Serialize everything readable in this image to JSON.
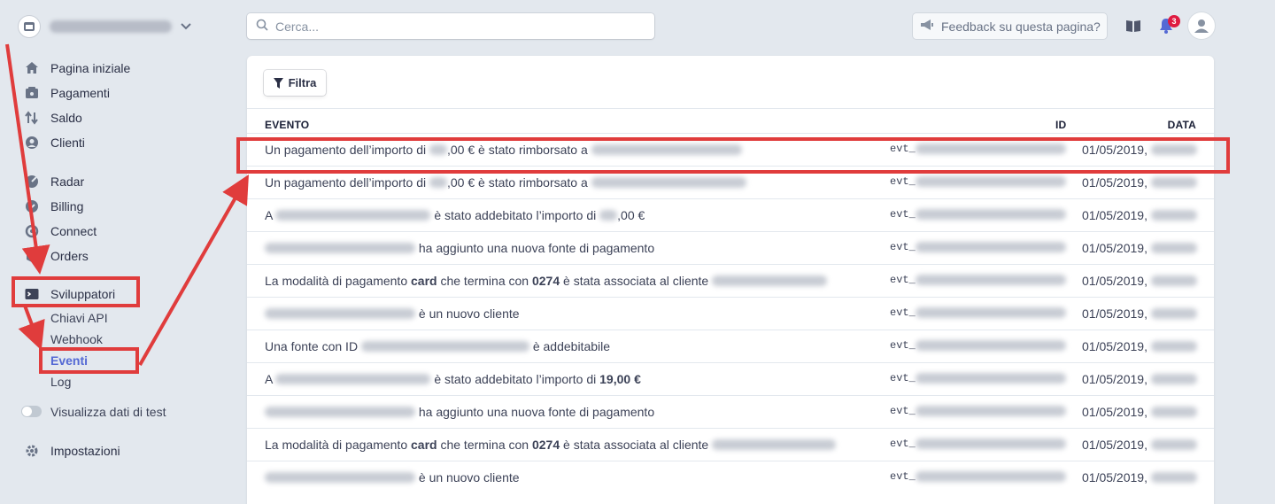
{
  "sidebar": {
    "nav_primary": [
      {
        "label": "Pagina iniziale",
        "icon": "home-icon"
      },
      {
        "label": "Pagamenti",
        "icon": "payments-icon"
      },
      {
        "label": "Saldo",
        "icon": "balance-icon"
      },
      {
        "label": "Clienti",
        "icon": "customers-icon"
      }
    ],
    "nav_secondary": [
      {
        "label": "Radar",
        "icon": "radar-icon"
      },
      {
        "label": "Billing",
        "icon": "billing-icon"
      },
      {
        "label": "Connect",
        "icon": "connect-icon"
      },
      {
        "label": "Orders",
        "icon": "orders-icon"
      }
    ],
    "developers": {
      "label": "Sviluppatori",
      "icon": "terminal-icon",
      "sub_items": [
        "Chiavi API",
        "Webhook",
        "Eventi",
        "Log"
      ],
      "active": "Eventi"
    },
    "test_toggle_label": "Visualizza dati di test",
    "settings_label": "Impostazioni"
  },
  "topbar": {
    "search_placeholder": "Cerca...",
    "feedback_label": "Feedback su questa pagina?",
    "notification_count": "3"
  },
  "main": {
    "filter_label": "Filtra",
    "columns": {
      "event": "EVENTO",
      "id": "ID",
      "date": "DATA"
    },
    "rows": [
      {
        "parts": [
          "Un pagamento dell’importo di ",
          "{B:20}",
          ",00 € è stato rimborsato a ",
          "{B:170}"
        ],
        "id_prefix": "evt_",
        "date": "01/05/2019,"
      },
      {
        "parts": [
          "Un pagamento dell’importo di ",
          "{B:20}",
          ",00 € è stato rimborsato a ",
          "{B:175}"
        ],
        "id_prefix": "evt_",
        "date": "01/05/2019,"
      },
      {
        "parts": [
          "A ",
          "{B:175}",
          " è stato addebitato l’importo di ",
          "{B:20}",
          ",00 €"
        ],
        "id_prefix": "evt_",
        "date": "01/05/2019,"
      },
      {
        "parts": [
          "{B:170}",
          " ha aggiunto una nuova fonte di pagamento"
        ],
        "id_prefix": "evt_",
        "date": "01/05/2019,"
      },
      {
        "parts": [
          "La modalità di pagamento ",
          "*card",
          " che termina con ",
          "*0274",
          " è stata associata al cliente ",
          "{B:130}"
        ],
        "id_prefix": "evt_",
        "date": "01/05/2019,"
      },
      {
        "parts": [
          "{B:170}",
          " è un nuovo cliente"
        ],
        "id_prefix": "evt_",
        "date": "01/05/2019,"
      },
      {
        "parts": [
          "Una fonte con ID ",
          "{B:190}",
          " è addebitabile"
        ],
        "id_prefix": "evt_",
        "date": "01/05/2019,"
      },
      {
        "parts": [
          "A ",
          "{B:175}",
          " è stato addebitato l’importo di ",
          "*19,00 €"
        ],
        "id_prefix": "evt_",
        "date": "01/05/2019,"
      },
      {
        "parts": [
          "{B:170}",
          " ha aggiunto una nuova fonte di pagamento"
        ],
        "id_prefix": "evt_",
        "date": "01/05/2019,"
      },
      {
        "parts": [
          "La modalità di pagamento ",
          "*card",
          " che termina con ",
          "*0274",
          " è stata associata al cliente ",
          "{B:140}"
        ],
        "id_prefix": "evt_",
        "date": "01/05/2019,"
      },
      {
        "parts": [
          "{B:170}",
          " è un nuovo cliente"
        ],
        "id_prefix": "evt_",
        "date": "01/05/2019,"
      }
    ]
  },
  "colors": {
    "accent": "#5469d4",
    "annotation": "#e03c3c",
    "background": "#e3e8ee"
  }
}
